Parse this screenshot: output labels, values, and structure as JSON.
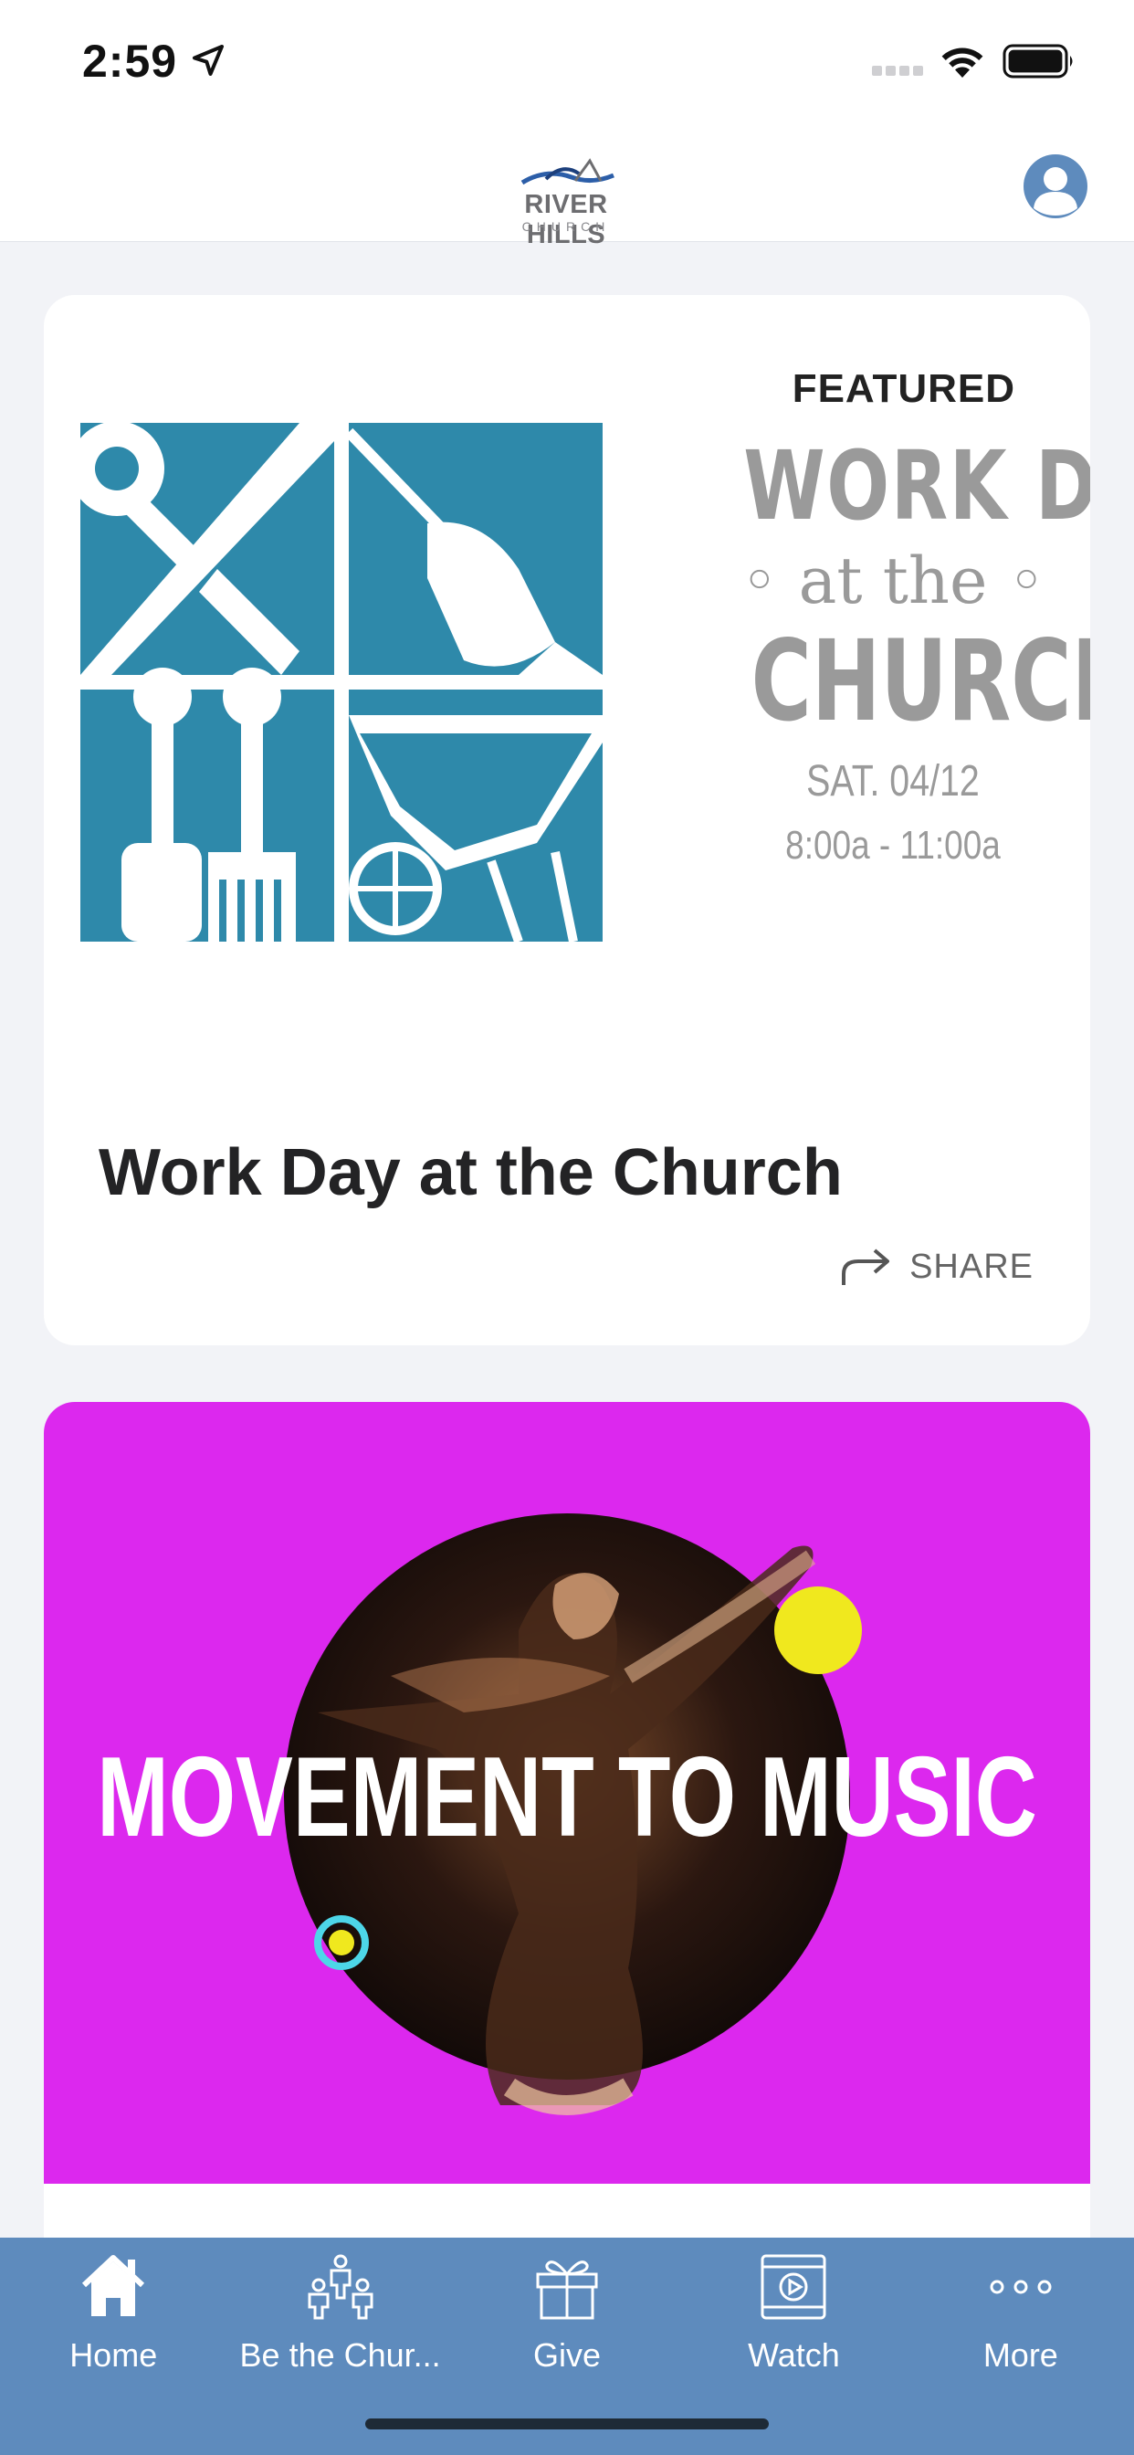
{
  "status_bar": {
    "time": "2:59",
    "icons": [
      "location-arrow-icon",
      "cellular-signal-icon",
      "wifi-icon",
      "battery-icon"
    ]
  },
  "header": {
    "logo_name": "RIVER HILLS",
    "logo_sub": "CHURCH",
    "profile_icon": "user-circle-icon"
  },
  "featured_card": {
    "label": "FEATURED",
    "image": {
      "line1": "WORK DAY",
      "line2": "◦ at  the ◦",
      "line3": "CHURCH",
      "line4": "SAT. 04/12",
      "line5": "8:00a - 11:00a",
      "accent": "#2e89aa"
    },
    "title": "Work Day at the Church",
    "share_label": "SHARE"
  },
  "music_card": {
    "image_text": "MOVEMENT TO MUSIC",
    "background": "#dc28ee"
  },
  "tab_bar": {
    "background": "#5e8bbd",
    "tabs": [
      {
        "label": "Home",
        "icon": "home-icon"
      },
      {
        "label": "Be the Chur...",
        "icon": "people-icon"
      },
      {
        "label": "Give",
        "icon": "gift-icon"
      },
      {
        "label": "Watch",
        "icon": "video-icon"
      },
      {
        "label": "More",
        "icon": "more-dots-icon"
      }
    ]
  }
}
